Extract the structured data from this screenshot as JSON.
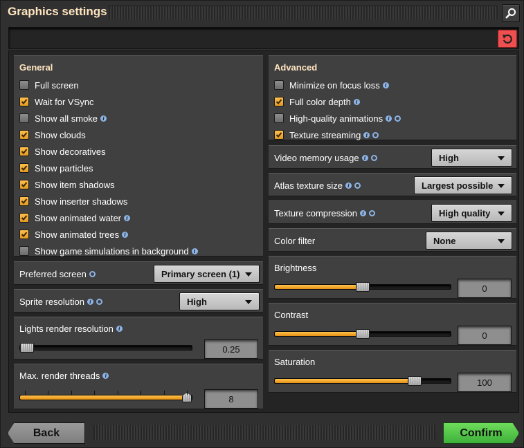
{
  "window": {
    "title": "Graphics settings"
  },
  "icons": {
    "search": "search-icon",
    "reset": "reset-icon",
    "info": "info-icon",
    "restart": "restart-required-icon",
    "check": "check-icon"
  },
  "colors": {
    "accent_orange": "#f5a623",
    "title_text": "#ffe6c0",
    "reset_red": "#ef4f4f",
    "confirm_green": "#5ccb49",
    "info_blue": "#8cb4e6"
  },
  "general": {
    "title": "General",
    "checkboxes": [
      {
        "label": "Full screen",
        "checked": false,
        "info": false,
        "restart": false
      },
      {
        "label": "Wait for VSync",
        "checked": true,
        "info": false,
        "restart": false
      },
      {
        "label": "Show all smoke",
        "checked": false,
        "info": true,
        "restart": false
      },
      {
        "label": "Show clouds",
        "checked": true,
        "info": false,
        "restart": false
      },
      {
        "label": "Show decoratives",
        "checked": true,
        "info": false,
        "restart": false
      },
      {
        "label": "Show particles",
        "checked": true,
        "info": false,
        "restart": false
      },
      {
        "label": "Show item shadows",
        "checked": true,
        "info": false,
        "restart": false
      },
      {
        "label": "Show inserter shadows",
        "checked": true,
        "info": false,
        "restart": false
      },
      {
        "label": "Show animated water",
        "checked": true,
        "info": true,
        "restart": false
      },
      {
        "label": "Show animated trees",
        "checked": true,
        "info": true,
        "restart": false
      },
      {
        "label": "Show game simulations in background",
        "checked": false,
        "info": true,
        "restart": false
      }
    ],
    "preferred_screen": {
      "label": "Preferred screen",
      "value": "Primary screen (1)"
    },
    "sprite_resolution": {
      "label": "Sprite resolution",
      "value": "High"
    },
    "lights_render_resolution": {
      "label": "Lights render resolution",
      "value": "0.25",
      "fraction": 0.0
    },
    "max_render_threads": {
      "label": "Max. render threads",
      "value": "8",
      "fraction": 1.0,
      "ticks": 8
    }
  },
  "advanced": {
    "title": "Advanced",
    "checkboxes": [
      {
        "label": "Minimize on focus loss",
        "checked": false,
        "info": true,
        "restart": false
      },
      {
        "label": "Full color depth",
        "checked": true,
        "info": true,
        "restart": false
      },
      {
        "label": "High-quality animations",
        "checked": false,
        "info": true,
        "restart": true
      },
      {
        "label": "Texture streaming",
        "checked": true,
        "info": true,
        "restart": true
      }
    ],
    "video_memory_usage": {
      "label": "Video memory usage",
      "value": "High"
    },
    "atlas_texture_size": {
      "label": "Atlas texture size",
      "value": "Largest possible"
    },
    "texture_compression": {
      "label": "Texture compression",
      "value": "High quality"
    },
    "color_filter": {
      "label": "Color filter",
      "value": "None"
    },
    "brightness": {
      "label": "Brightness",
      "value": "0",
      "fraction": 0.5
    },
    "contrast": {
      "label": "Contrast",
      "value": "0",
      "fraction": 0.5
    },
    "saturation": {
      "label": "Saturation",
      "value": "100",
      "fraction": 0.82
    }
  },
  "footer": {
    "back_label": "Back",
    "confirm_label": "Confirm"
  }
}
